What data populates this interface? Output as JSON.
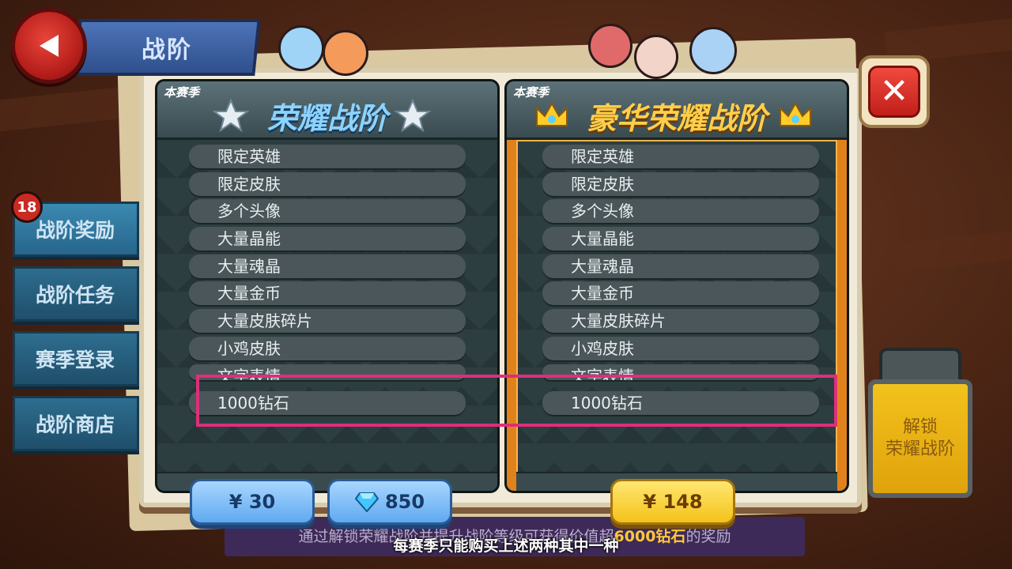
{
  "header": {
    "title": "战阶"
  },
  "sidebar": {
    "badge": "18",
    "tabs": [
      {
        "label": "战阶奖励"
      },
      {
        "label": "战阶任务"
      },
      {
        "label": "赛季登录"
      },
      {
        "label": "战阶商店"
      }
    ]
  },
  "panels": {
    "left": {
      "season_tag": "本赛季",
      "title": "荣耀战阶",
      "items": [
        "限定英雄",
        "限定皮肤",
        "多个头像",
        "大量晶能",
        "大量魂晶",
        "大量金币",
        "大量皮肤碎片",
        "小鸡皮肤",
        "文字表情",
        "1000钻石"
      ]
    },
    "right": {
      "season_tag": "本赛季",
      "title": "豪华荣耀战阶",
      "items": [
        "限定英雄",
        "限定皮肤",
        "多个头像",
        "大量晶能",
        "大量魂晶",
        "大量金币",
        "大量皮肤碎片",
        "小鸡皮肤",
        "文字表情",
        "1000钻石"
      ]
    }
  },
  "prices": {
    "basic_rmb": "¥ 30",
    "basic_gems": "850",
    "deluxe_rmb": "¥ 148"
  },
  "footer": {
    "info_before": "通过解锁荣耀战阶并提升战阶等级可获得价值超",
    "info_highlight": "6000钻石",
    "info_after": "的奖励",
    "subtitle": "每赛季只能购买上述两种其中一种"
  },
  "unlock": {
    "line1": "解锁",
    "line2": "荣耀战阶"
  },
  "colors": {
    "highlight_box": "#dd2f7a",
    "gold_accent": "#f4c21a",
    "blue_accent": "#5fa9f0"
  },
  "icons": [
    "play-back-icon",
    "close-icon",
    "star-icon",
    "crown-icon",
    "diamond-icon"
  ]
}
